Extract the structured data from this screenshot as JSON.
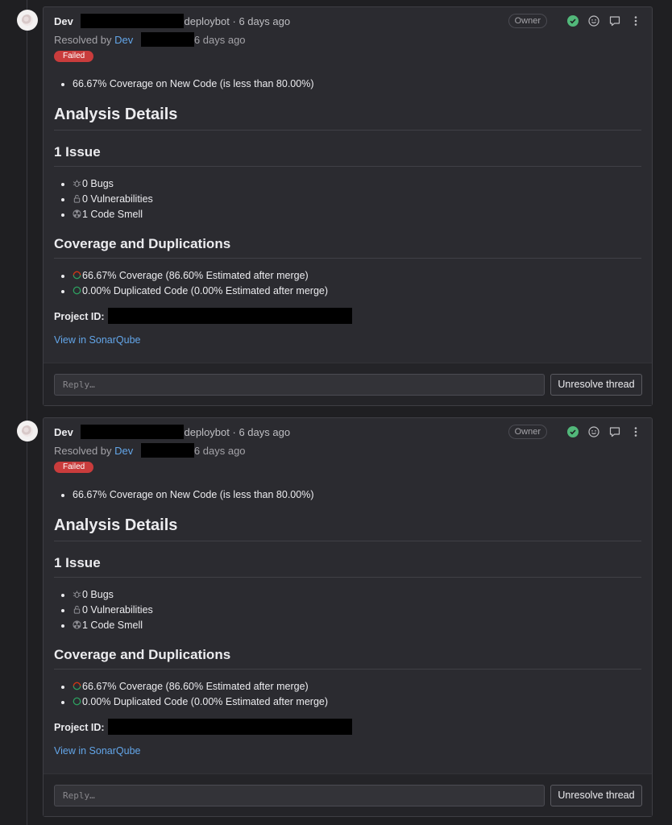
{
  "threads": [
    {
      "author": "Dev",
      "username": "deploybot",
      "separator": "·",
      "time": "6 days ago",
      "resolved_prefix": "Resolved by",
      "resolved_by": "Dev",
      "resolved_time": "6 days ago",
      "status_badge": "Failed",
      "owner_badge": "Owner",
      "coverage_condition": "66.67% Coverage on New Code (is less than 80.00%)",
      "analysis_heading": "Analysis Details",
      "issues_heading": "1 Issue",
      "issues": [
        "0 Bugs",
        "0 Vulnerabilities",
        "1 Code Smell"
      ],
      "coverage_heading": "Coverage and Duplications",
      "coverage_items": [
        "66.67% Coverage (86.60% Estimated after merge)",
        "0.00% Duplicated Code (0.00% Estimated after merge)"
      ],
      "project_label": "Project ID:",
      "sonar_link": "View in SonarQube",
      "reply_placeholder": "Reply…",
      "unresolve_label": "Unresolve thread"
    },
    {
      "author": "Dev",
      "username": "deploybot",
      "separator": "·",
      "time": "6 days ago",
      "resolved_prefix": "Resolved by",
      "resolved_by": "Dev",
      "resolved_time": "6 days ago",
      "status_badge": "Failed",
      "owner_badge": "Owner",
      "coverage_condition": "66.67% Coverage on New Code (is less than 80.00%)",
      "analysis_heading": "Analysis Details",
      "issues_heading": "1 Issue",
      "issues": [
        "0 Bugs",
        "0 Vulnerabilities",
        "1 Code Smell"
      ],
      "coverage_heading": "Coverage and Duplications",
      "coverage_items": [
        "66.67% Coverage (86.60% Estimated after merge)",
        "0.00% Duplicated Code (0.00% Estimated after merge)"
      ],
      "project_label": "Project ID:",
      "sonar_link": "View in SonarQube",
      "reply_placeholder": "Reply…",
      "unresolve_label": "Unresolve thread"
    }
  ],
  "colors": {
    "failed": "#c93c3c",
    "link": "#63a6e9",
    "resolved_check": "#52b87a",
    "coverage_bad": "#dd2b0e",
    "coverage_good": "#2da160"
  }
}
